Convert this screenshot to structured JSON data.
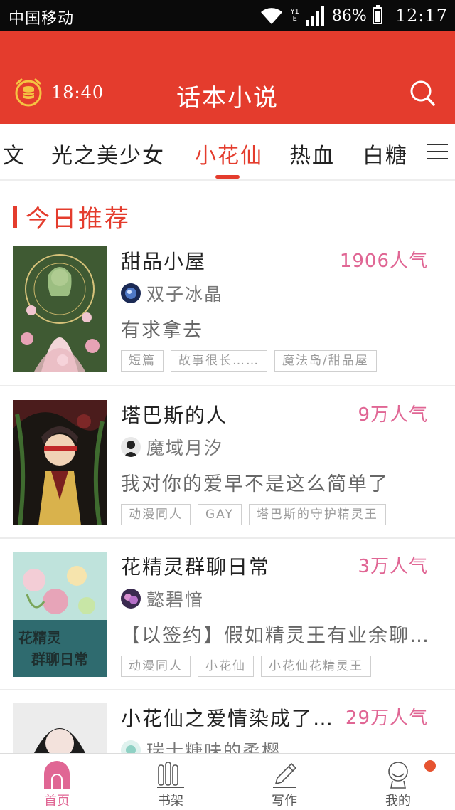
{
  "status_bar": {
    "carrier": "中国移动",
    "net_top": "Y1",
    "net_bottom": "E",
    "battery_pct": "86%",
    "battery_level": 0.86,
    "time": "12:17"
  },
  "header": {
    "timer": "18:40",
    "title": "话本小说",
    "timer_icon": "alarm-coin-icon",
    "search_icon": "search-icon"
  },
  "tabs": {
    "items": [
      {
        "label": "文"
      },
      {
        "label": "光之美少女"
      },
      {
        "label": "小花仙"
      },
      {
        "label": "热血"
      },
      {
        "label": "白糖"
      }
    ],
    "active_index": 2,
    "menu_icon": "hamburger-menu-icon"
  },
  "section": {
    "title": "今日推荐"
  },
  "stories": [
    {
      "title": "甜品小屋",
      "popularity": "1906人气",
      "author": "双子冰晶",
      "description": "有求拿去",
      "tags": [
        "短篇",
        "故事很长……",
        "魔法岛/甜品屋"
      ]
    },
    {
      "title": "塔巴斯的人",
      "popularity": "9万人气",
      "author": "魔域月汐",
      "description": "我对你的爱早不是这么简单了",
      "tags": [
        "动漫同人",
        "GAY",
        "塔巴斯的守护精灵王"
      ]
    },
    {
      "title": "花精灵群聊日常",
      "popularity": "3万人气",
      "author": "懿碧愔",
      "description": "【以签约】假如精灵王有业余聊…",
      "tags": [
        "动漫同人",
        "小花仙",
        "小花仙花精灵王"
      ],
      "cover_text": "花精灵群聊日常"
    },
    {
      "title": "小花仙之爱情染成了…",
      "popularity": "29万人气",
      "author": "瑞士糖味的柔樱"
    }
  ],
  "bottom_nav": {
    "items": [
      {
        "label": "首页",
        "icon": "home-icon"
      },
      {
        "label": "书架",
        "icon": "bookshelf-icon"
      },
      {
        "label": "写作",
        "icon": "pen-icon"
      },
      {
        "label": "我的",
        "icon": "profile-icon"
      }
    ],
    "active_index": 0
  },
  "colors": {
    "brand_red": "#e43c2d",
    "popularity_pink": "#e06694",
    "notification_dot": "#e65330"
  }
}
